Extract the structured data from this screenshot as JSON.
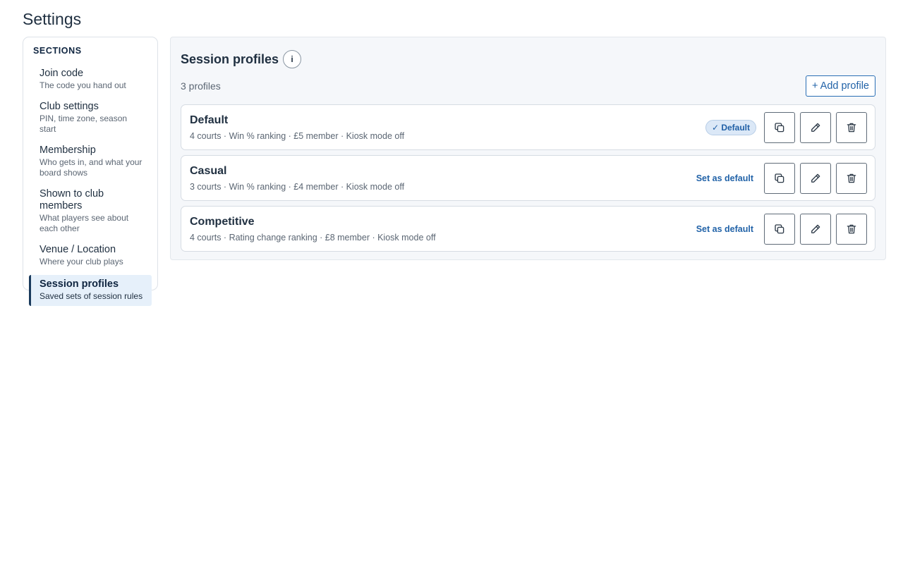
{
  "page": {
    "title": "Settings"
  },
  "sidebar": {
    "heading": "SECTIONS",
    "items": [
      {
        "label": "Join code",
        "sublabel": "The code you hand out",
        "active": false
      },
      {
        "label": "Club settings",
        "sublabel": "PIN, time zone, season start",
        "active": false
      },
      {
        "label": "Membership",
        "sublabel": "Who gets in, and what your board shows",
        "active": false
      },
      {
        "label": "Shown to club members",
        "sublabel": "What players see about each other",
        "active": false
      },
      {
        "label": "Venue / Location",
        "sublabel": "Where your club plays",
        "active": false
      },
      {
        "label": "Session profiles",
        "sublabel": "Saved sets of session rules",
        "active": true
      }
    ]
  },
  "main": {
    "title": "Session profiles",
    "info_icon_label": "i",
    "count": "3 profiles",
    "add_label": "+ Add profile",
    "profiles": [
      {
        "name": "Default",
        "meta": "4 courts · Win % ranking · £5 member · Kiosk mode off",
        "is_default": true,
        "badge": "✓ Default"
      },
      {
        "name": "Casual",
        "meta": "3 courts · Win % ranking · £4 member · Kiosk mode off",
        "is_default": false,
        "action": "Set as default"
      },
      {
        "name": "Competitive",
        "meta": "4 courts · Rating change ranking · £8 member · Kiosk mode off",
        "is_default": false,
        "action": "Set as default"
      }
    ],
    "row_actions": [
      "copy-icon",
      "pencil-icon",
      "trash-icon"
    ]
  },
  "colors": {
    "accent": "#2263a8",
    "active_nav_bg": "#e6f0fa",
    "active_nav_border": "#1a3a5c",
    "badge_bg": "#dbe8f7"
  }
}
